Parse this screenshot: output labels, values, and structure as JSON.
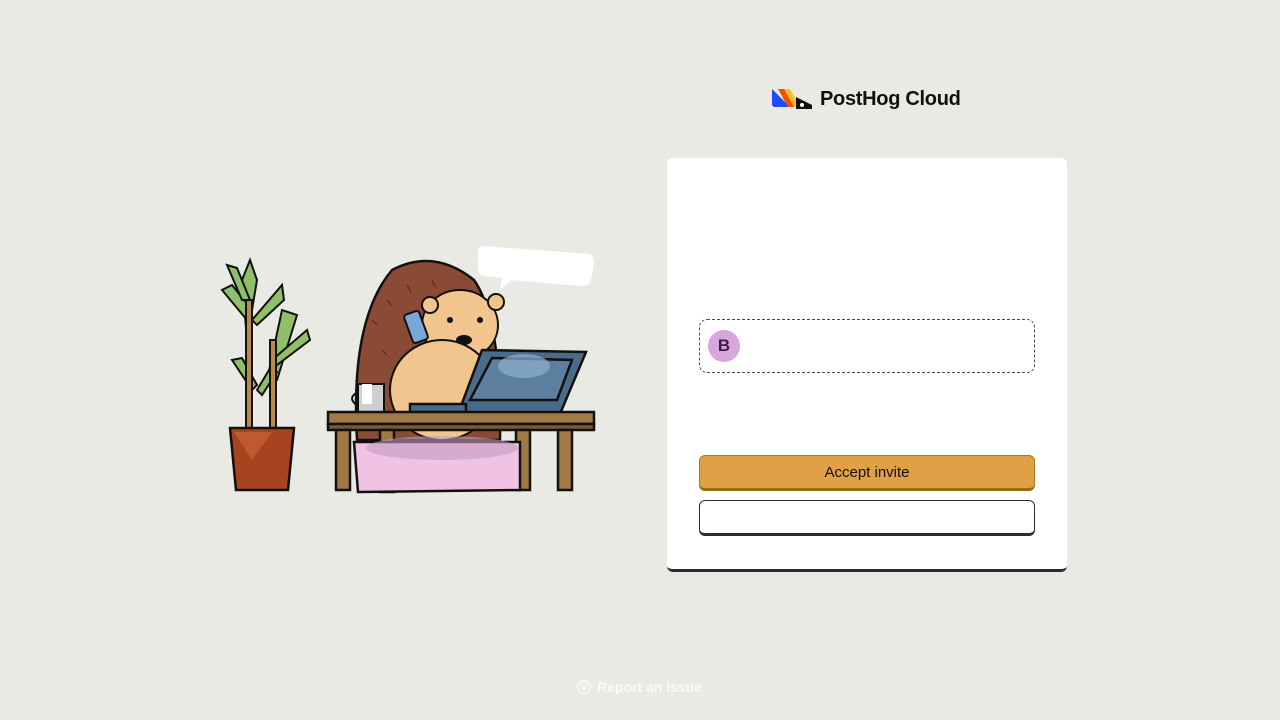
{
  "brand": {
    "name": "PostHog Cloud",
    "logo_icon": "posthog-logo-icon"
  },
  "illustration": {
    "name": "hedgehog-at-desk-illustration"
  },
  "invite": {
    "avatar_initial": "B",
    "accept_label": "Accept invite",
    "secondary_label": ""
  },
  "footer": {
    "report_label": "Report an issue",
    "report_icon": "bug-icon"
  },
  "colors": {
    "background": "#eaeae5",
    "card": "#ffffff",
    "primary_button": "#e0a045",
    "avatar": "#d6a6dd"
  }
}
